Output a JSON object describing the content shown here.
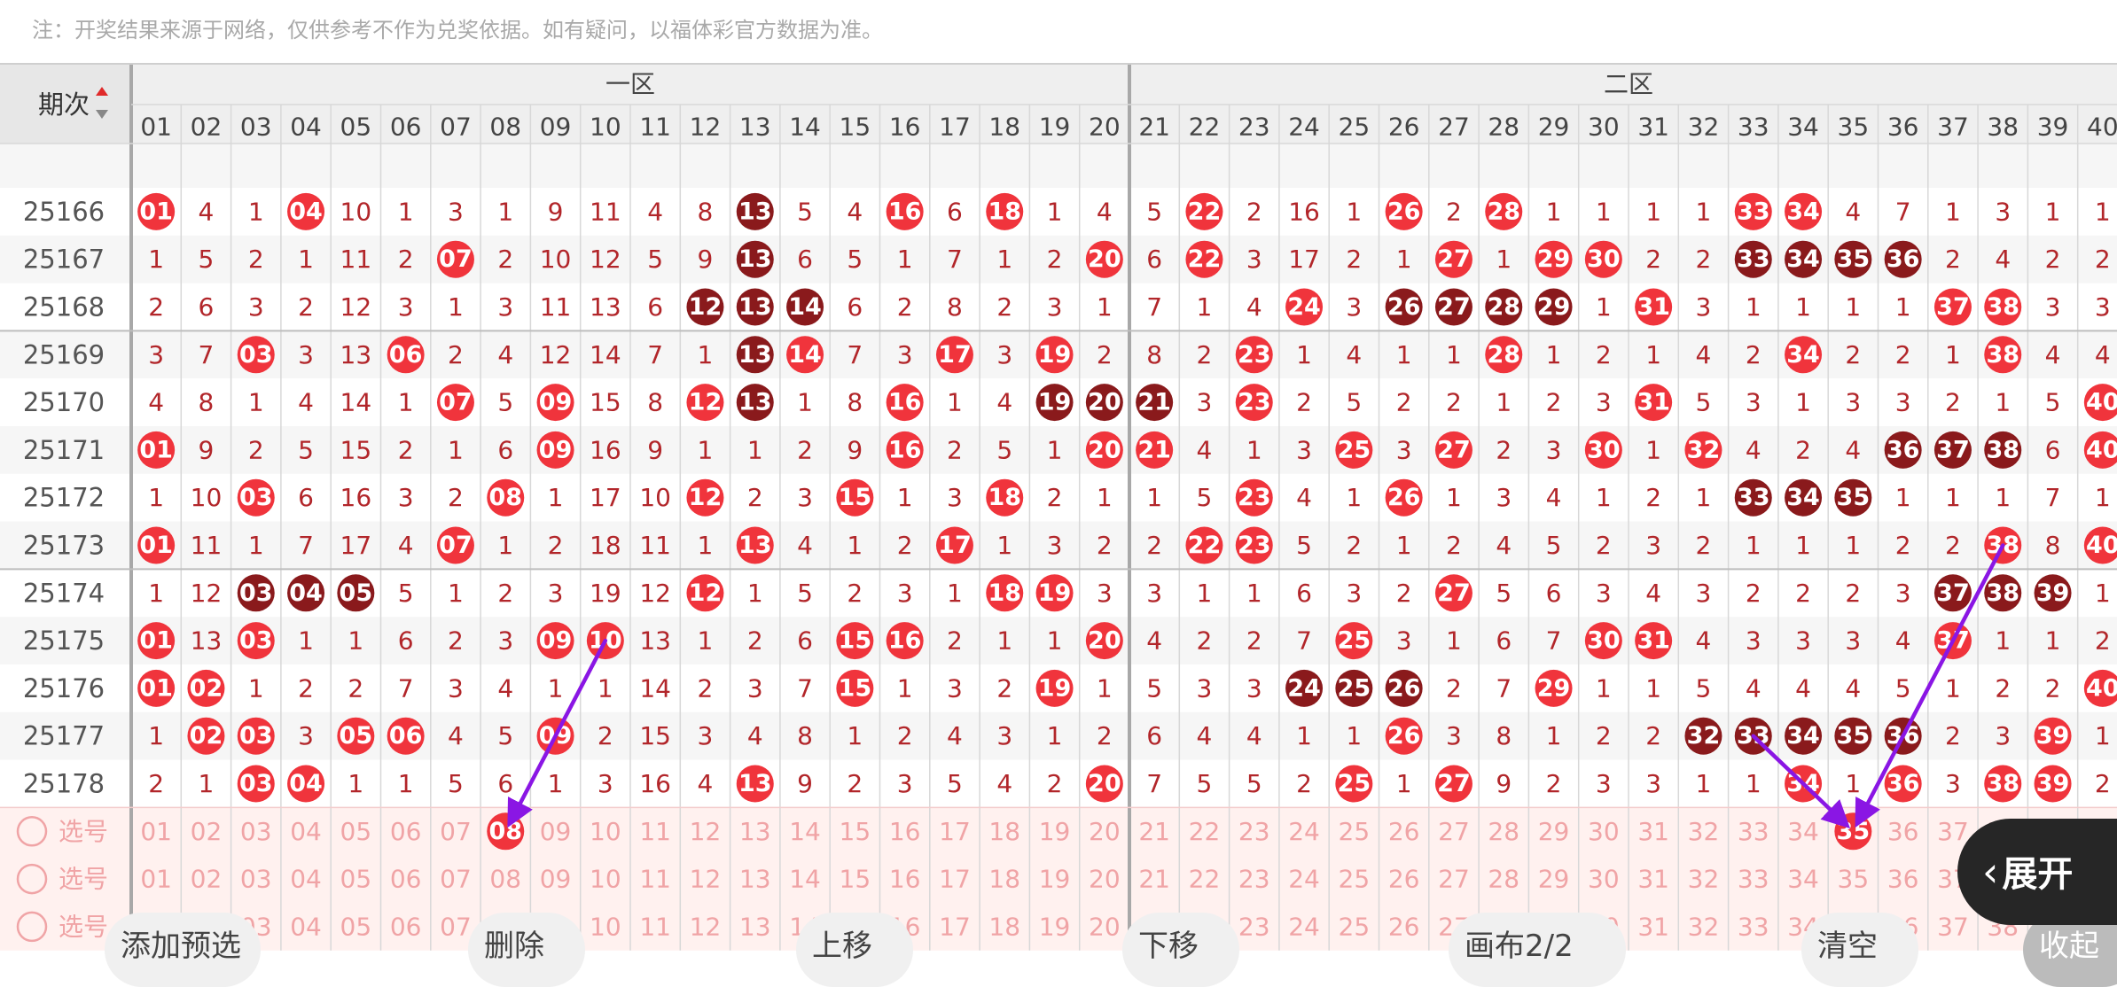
{
  "notice": "注：开奖结果来源于网络，仅供参考不作为兑奖依据。如有疑问，以福体彩官方数据为准。",
  "table": {
    "period_header": "期次",
    "zone1_label": "一区",
    "zone2_label": "二区",
    "columns": [
      "01",
      "02",
      "03",
      "04",
      "05",
      "06",
      "07",
      "08",
      "09",
      "10",
      "11",
      "12",
      "13",
      "14",
      "15",
      "16",
      "17",
      "18",
      "19",
      "20",
      "21",
      "22",
      "23",
      "24",
      "25",
      "26",
      "27",
      "28",
      "29",
      "30",
      "31",
      "32",
      "33",
      "34",
      "35",
      "36",
      "37",
      "38",
      "39",
      "40"
    ],
    "rows": [
      {
        "period": "25166",
        "cells": [
          0,
          4,
          1,
          0,
          10,
          1,
          3,
          1,
          9,
          11,
          4,
          8,
          0,
          5,
          4,
          0,
          6,
          0,
          1,
          4,
          5,
          0,
          2,
          16,
          1,
          0,
          2,
          0,
          1,
          1,
          1,
          1,
          0,
          0,
          4,
          7,
          1,
          3,
          1,
          1
        ],
        "hits": [
          1,
          4,
          13,
          16,
          18,
          22,
          26,
          28,
          33,
          34
        ],
        "dark": [
          13
        ]
      },
      {
        "period": "25167",
        "cells": [
          1,
          5,
          2,
          1,
          11,
          2,
          0,
          2,
          10,
          12,
          5,
          9,
          0,
          6,
          5,
          1,
          7,
          1,
          2,
          0,
          6,
          0,
          3,
          17,
          2,
          1,
          0,
          1,
          0,
          0,
          2,
          2,
          0,
          0,
          0,
          0,
          2,
          4,
          2,
          2
        ],
        "hits": [
          7,
          13,
          20,
          22,
          27,
          29,
          30,
          33,
          34,
          35,
          36
        ],
        "dark": [
          13,
          33,
          34,
          35,
          36
        ]
      },
      {
        "period": "25168",
        "cells": [
          2,
          6,
          3,
          2,
          12,
          3,
          1,
          3,
          11,
          13,
          6,
          0,
          0,
          0,
          6,
          2,
          8,
          2,
          3,
          1,
          7,
          1,
          4,
          0,
          3,
          0,
          0,
          0,
          0,
          1,
          0,
          3,
          1,
          1,
          1,
          1,
          0,
          0,
          3,
          3
        ],
        "hits": [
          12,
          13,
          14,
          24,
          26,
          27,
          28,
          29,
          31,
          37,
          38
        ],
        "dark": [
          12,
          13,
          14,
          26,
          27,
          28,
          29
        ]
      },
      {
        "period": "25169",
        "cells": [
          3,
          7,
          0,
          3,
          13,
          0,
          2,
          4,
          12,
          14,
          7,
          1,
          0,
          0,
          7,
          3,
          0,
          3,
          0,
          2,
          8,
          2,
          0,
          1,
          4,
          1,
          1,
          0,
          1,
          2,
          1,
          4,
          2,
          0,
          2,
          2,
          1,
          0,
          4,
          4
        ],
        "hits": [
          3,
          6,
          13,
          14,
          17,
          19,
          23,
          28,
          34,
          38
        ],
        "dark": [
          13
        ]
      },
      {
        "period": "25170",
        "cells": [
          4,
          8,
          1,
          4,
          14,
          1,
          0,
          5,
          0,
          15,
          8,
          0,
          0,
          1,
          8,
          0,
          1,
          4,
          0,
          0,
          0,
          3,
          0,
          2,
          5,
          2,
          2,
          1,
          2,
          3,
          0,
          5,
          3,
          1,
          3,
          3,
          2,
          1,
          5,
          0
        ],
        "hits": [
          7,
          9,
          12,
          13,
          16,
          19,
          20,
          21,
          23,
          31,
          40
        ],
        "dark": [
          13,
          19,
          20,
          21
        ]
      },
      {
        "period": "25171",
        "cells": [
          0,
          9,
          2,
          5,
          15,
          2,
          1,
          6,
          0,
          16,
          9,
          1,
          1,
          2,
          9,
          0,
          2,
          5,
          1,
          0,
          0,
          4,
          1,
          3,
          0,
          3,
          0,
          2,
          3,
          0,
          1,
          0,
          4,
          2,
          4,
          0,
          0,
          0,
          6,
          0
        ],
        "hits": [
          1,
          9,
          16,
          20,
          21,
          25,
          27,
          30,
          32,
          36,
          37,
          38,
          40
        ],
        "dark": [
          36,
          37,
          38
        ]
      },
      {
        "period": "25172",
        "cells": [
          1,
          10,
          0,
          6,
          16,
          3,
          2,
          0,
          1,
          17,
          10,
          0,
          2,
          3,
          0,
          1,
          3,
          0,
          2,
          1,
          1,
          5,
          0,
          4,
          1,
          0,
          1,
          3,
          4,
          1,
          2,
          1,
          0,
          0,
          0,
          1,
          1,
          1,
          7,
          1
        ],
        "hits": [
          3,
          8,
          12,
          15,
          18,
          23,
          26,
          33,
          34,
          35
        ],
        "dark": [
          33,
          34,
          35
        ]
      },
      {
        "period": "25173",
        "cells": [
          0,
          11,
          1,
          7,
          17,
          4,
          0,
          1,
          2,
          18,
          11,
          1,
          0,
          4,
          1,
          2,
          0,
          1,
          3,
          2,
          2,
          0,
          0,
          5,
          2,
          1,
          2,
          4,
          5,
          2,
          3,
          2,
          1,
          1,
          1,
          2,
          2,
          0,
          8,
          0
        ],
        "hits": [
          1,
          7,
          13,
          17,
          22,
          23,
          38,
          40
        ],
        "dark": []
      },
      {
        "period": "25174",
        "cells": [
          1,
          12,
          0,
          0,
          0,
          5,
          1,
          2,
          3,
          19,
          12,
          0,
          1,
          5,
          2,
          3,
          1,
          0,
          0,
          3,
          3,
          1,
          1,
          6,
          3,
          2,
          0,
          5,
          6,
          3,
          4,
          3,
          2,
          2,
          2,
          3,
          0,
          0,
          0,
          1
        ],
        "hits": [
          3,
          4,
          5,
          12,
          18,
          19,
          27,
          37,
          38,
          39
        ],
        "dark": [
          3,
          4,
          5,
          37,
          38,
          39
        ]
      },
      {
        "period": "25175",
        "cells": [
          0,
          13,
          0,
          1,
          1,
          6,
          2,
          3,
          0,
          0,
          13,
          1,
          2,
          6,
          0,
          0,
          2,
          1,
          1,
          0,
          4,
          2,
          2,
          7,
          0,
          3,
          1,
          6,
          7,
          0,
          0,
          4,
          3,
          3,
          3,
          4,
          0,
          1,
          1,
          2
        ],
        "hits": [
          1,
          3,
          9,
          10,
          15,
          16,
          20,
          25,
          30,
          31,
          37
        ],
        "dark": []
      },
      {
        "period": "25176",
        "cells": [
          0,
          0,
          1,
          2,
          2,
          7,
          3,
          4,
          1,
          1,
          14,
          2,
          3,
          7,
          0,
          1,
          3,
          2,
          0,
          1,
          5,
          3,
          3,
          0,
          0,
          0,
          2,
          7,
          0,
          1,
          1,
          5,
          4,
          4,
          4,
          5,
          1,
          2,
          2,
          0
        ],
        "hits": [
          1,
          2,
          15,
          19,
          24,
          25,
          26,
          29,
          40
        ],
        "dark": [
          24,
          25,
          26
        ]
      },
      {
        "period": "25177",
        "cells": [
          1,
          0,
          0,
          3,
          0,
          0,
          4,
          5,
          0,
          2,
          15,
          3,
          4,
          8,
          1,
          2,
          4,
          3,
          1,
          2,
          6,
          4,
          4,
          1,
          1,
          0,
          3,
          8,
          1,
          2,
          2,
          0,
          0,
          0,
          0,
          0,
          2,
          3,
          0,
          1
        ],
        "hits": [
          2,
          3,
          5,
          6,
          9,
          26,
          32,
          33,
          34,
          35,
          36,
          39
        ],
        "dark": [
          32,
          33,
          34,
          35,
          36
        ]
      },
      {
        "period": "25178",
        "cells": [
          2,
          1,
          0,
          0,
          1,
          1,
          5,
          6,
          1,
          3,
          16,
          4,
          0,
          9,
          2,
          3,
          5,
          4,
          2,
          0,
          7,
          5,
          5,
          2,
          0,
          1,
          0,
          9,
          2,
          3,
          3,
          1,
          1,
          0,
          1,
          0,
          3,
          0,
          0,
          2
        ],
        "hits": [
          3,
          4,
          13,
          20,
          25,
          27,
          34,
          36,
          38,
          39
        ],
        "dark": []
      }
    ],
    "select_rows": [
      {
        "label": "选号",
        "selected": [
          8,
          35
        ]
      },
      {
        "label": "选号",
        "selected": []
      },
      {
        "label": "选号",
        "selected": []
      }
    ]
  },
  "buttons": {
    "add": "添加预选",
    "delete": "删除",
    "up": "上移",
    "down": "下移",
    "canvas": "画布2/2",
    "clear": "清空",
    "collapse": "收起",
    "expand": "展开"
  },
  "colors": {
    "hit": "#f0343c",
    "dark": "#8a1a1c",
    "miss_text": "#b2262a",
    "select_text": "#f0a4a6",
    "select_bg": "#fff1ef",
    "arrow": "#8a16e4",
    "grid": "#d8d8d8",
    "header_bg": "#efefef"
  },
  "icons": {
    "sort": "sort-updown-icon",
    "radio": "radio-circle-icon",
    "chevron": "chevron-left-icon",
    "arrow": "annotation-arrow-icon"
  }
}
